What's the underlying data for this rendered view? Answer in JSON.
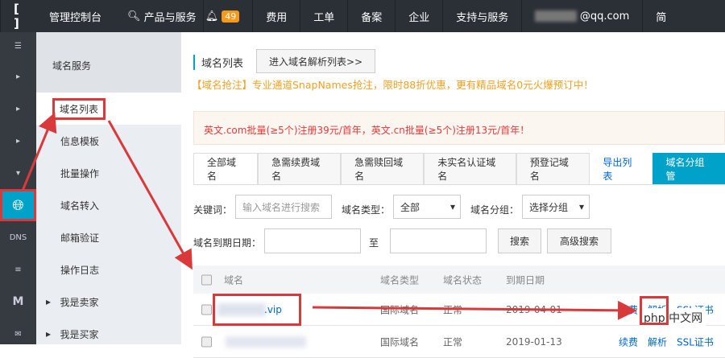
{
  "topbar": {
    "logo": "[ ]",
    "console": "管理控制台",
    "search": "搜索",
    "products": "产品与服务",
    "badge": "49",
    "items": [
      "费用",
      "工单",
      "备案",
      "企业",
      "支持与服务"
    ],
    "account": "@qq.com",
    "lang": "简"
  },
  "rail": {
    "menu_icon": "☰",
    "dns": "DNS",
    "m": "M"
  },
  "sidebar": {
    "title": "域名服务",
    "items": [
      "域名列表",
      "信息模板",
      "批量操作",
      "域名转入",
      "邮箱验证",
      "操作日志",
      "我是卖家",
      "我是买家"
    ]
  },
  "main": {
    "title": "域名列表",
    "goto_dns": "进入域名解析列表>>",
    "promo1": "【域名抢注】专业通道SnapNames抢注，限时88折优惠，更有精品域名0元火爆预订中！",
    "promo2": "英文.com批量(≥5个)注册39元/首年，英文.cn批量(≥5个)注册13元/首年！",
    "tabs": [
      "全部域名",
      "急需续费域名",
      "急需赎回域名",
      "未实名认证域名",
      "预登记域名"
    ],
    "export": "导出列表",
    "group_btn": "域名分组管",
    "filters": {
      "keyword_label": "关键词：",
      "keyword_ph": "输入域名进行搜索",
      "type_label": "域名类型：",
      "type_value": "全部",
      "group_label": "域名分组：",
      "group_value": "选择分组",
      "expire_label": "域名到期日期：",
      "to": "至",
      "search": "搜索",
      "advanced": "高级搜索"
    },
    "columns": [
      "域名",
      "域名类型",
      "域名状态",
      "到期日期"
    ],
    "rows": [
      {
        "domain": ".vip",
        "type": "国际域名",
        "status": "正常",
        "date": "2019-04-01",
        "actions": [
          "续费",
          "解析",
          "SSL证书"
        ]
      },
      {
        "domain": "",
        "type": "国际域名",
        "status": "正常",
        "date": "2019-01-13",
        "actions": [
          "续费",
          "解析",
          "SSL证书"
        ]
      }
    ],
    "watermark": "php 中文网"
  }
}
